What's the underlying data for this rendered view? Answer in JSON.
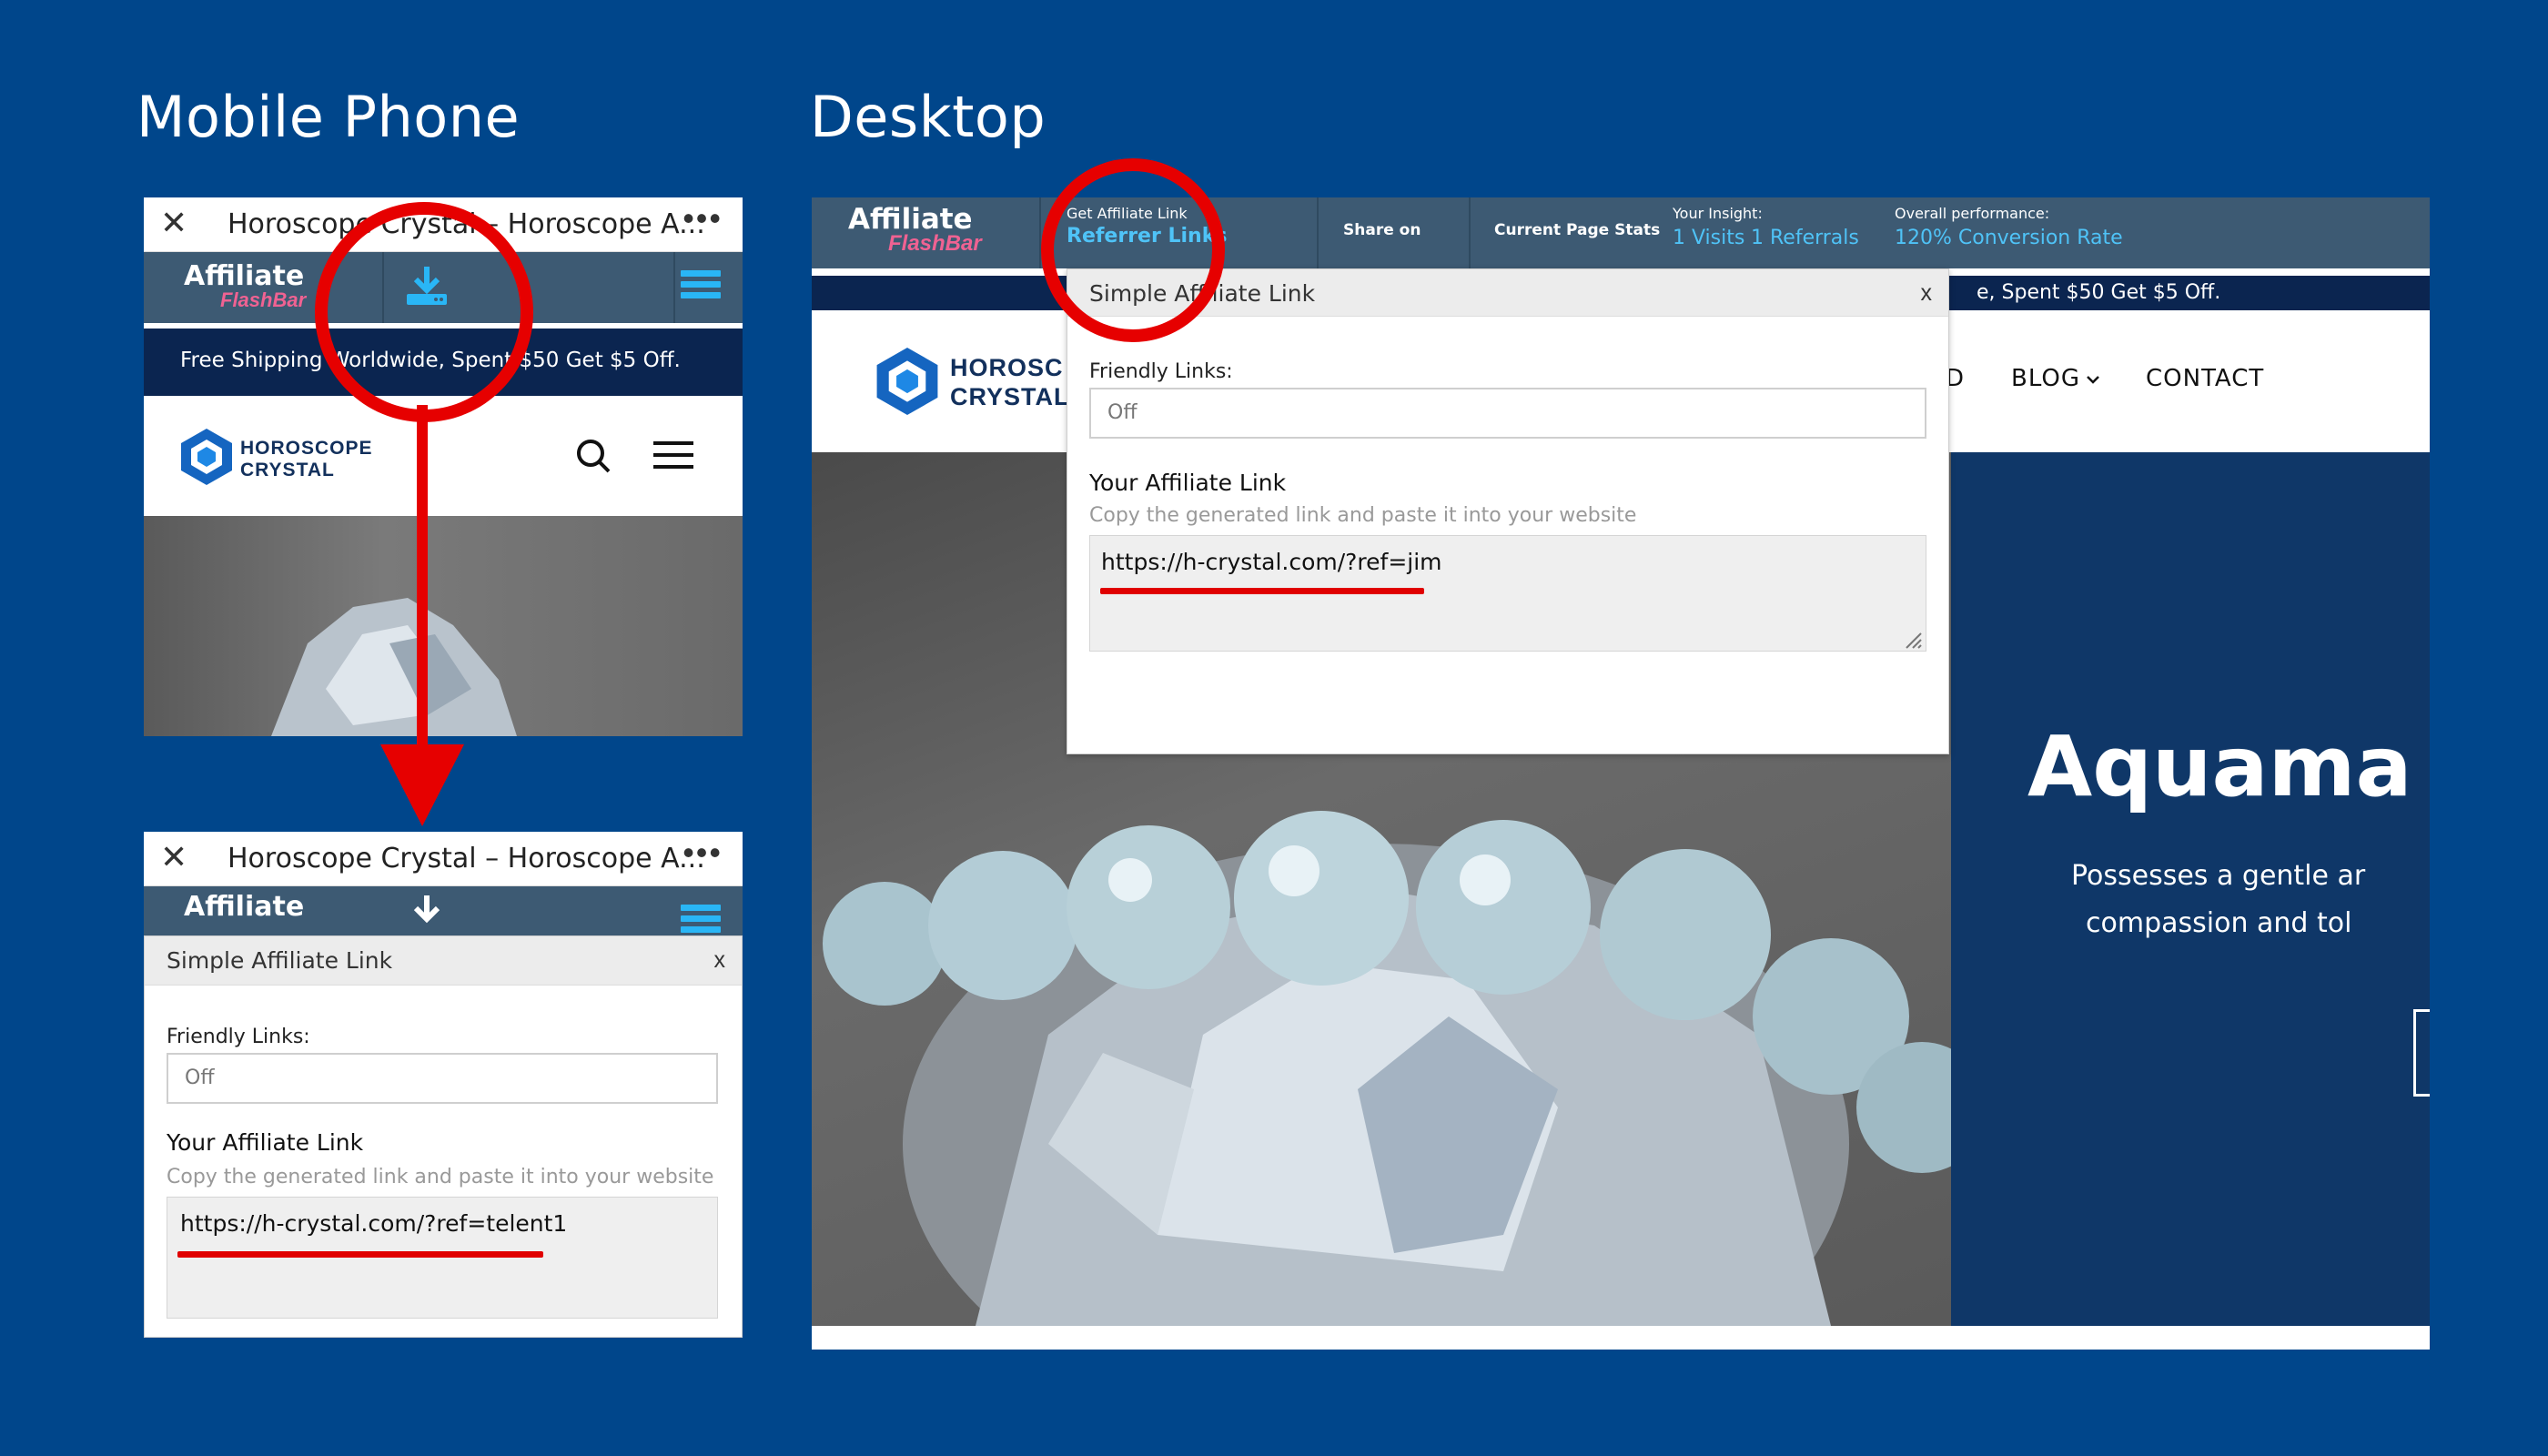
{
  "headings": {
    "mobile": "Mobile Phone",
    "desktop": "Desktop"
  },
  "phone": {
    "close_glyph": "✕",
    "title": "Horoscope Crystal – Horoscope A...",
    "more_glyph": "•••",
    "flashbar_logo_top": "Affiliate",
    "flashbar_logo_bottom": "FlashBar",
    "shipping_text": "Free Shipping Worldwide, Spent $50 Get $5 Off.",
    "site_logo_line1": "HOROSCOPE",
    "site_logo_line2": "CRYSTAL"
  },
  "popup_mobile": {
    "title": "Simple Affiliate Link",
    "close": "x",
    "friendly_label": "Friendly Links:",
    "friendly_value": "Off",
    "affiliate_heading": "Your Affiliate Link",
    "affiliate_hint": "Copy the generated link and paste it into your website",
    "affiliate_link": "https://h-crystal.com/?ref=telent1"
  },
  "desktop": {
    "flashbar": {
      "logo_top": "Affiliate",
      "logo_bottom": "FlashBar",
      "get_link_label": "Get Affiliate Link",
      "get_link_value": "Referrer Links",
      "share_label": "Share on",
      "stats_label": "Current Page Stats",
      "insight_label": "Your Insight:",
      "insight_visits": "1 Visits",
      "insight_referrals": "1 Referrals",
      "perf_label": "Overall performance:",
      "perf_value": "120% Conversion Rate"
    },
    "shipping_fragment": "e, Spent $50 Get $5 Off.",
    "site_logo_line1": "HOROSC",
    "site_logo_line2": "CRYSTAL",
    "nav": {
      "fragment": "D",
      "blog": "BLOG",
      "contact": "CONTACT"
    },
    "hero": {
      "title": "Aquama",
      "text_line1": "Possesses a gentle ar",
      "text_line2": "compassion and tol"
    },
    "popup": {
      "title": "Simple Affiliate Link",
      "close": "x",
      "friendly_label": "Friendly Links:",
      "friendly_value": "Off",
      "affiliate_heading": "Your Affiliate Link",
      "affiliate_hint": "Copy the generated link and paste it into your website",
      "affiliate_link": "https://h-crystal.com/?ref=jim"
    }
  },
  "colors": {
    "background": "#00468b",
    "flashbar": "#3d5a73",
    "accent_blue": "#29b6f6",
    "highlight_red": "#e60000",
    "flashbar_pink": "#f06292"
  },
  "icons": [
    "close-icon",
    "more-icon",
    "download-icon",
    "menu-icon",
    "search-icon",
    "hamburger-icon",
    "chevron-down-icon",
    "resize-handle-icon"
  ]
}
